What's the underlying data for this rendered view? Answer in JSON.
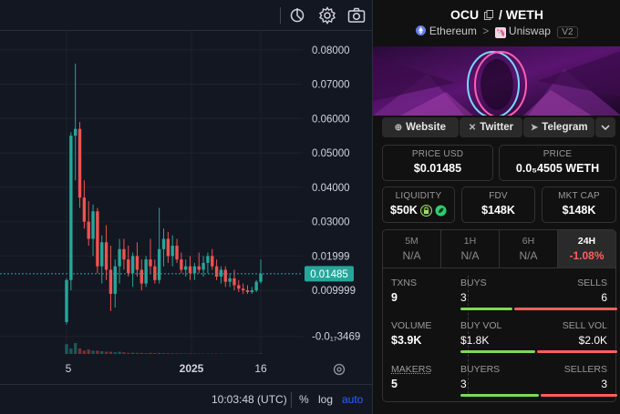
{
  "chart": {
    "price_axis": [
      "0.08000",
      "0.07000",
      "0.06000",
      "0.05000",
      "0.04000",
      "0.03000",
      "0.01999",
      "0.009999",
      "-0.0₁₇3469"
    ],
    "current_price_label": "0.01485",
    "x_ticks": [
      "5",
      "2025",
      "16"
    ],
    "time_label": "10:03:48 (UTC)",
    "percent_label": "%",
    "log_label": "log",
    "auto_label": "auto",
    "colors": {
      "up": "#26a69a",
      "down": "#ef5350",
      "background": "#131722"
    }
  },
  "chart_data": {
    "type": "candlestick",
    "y_range": [
      -0.0085,
      0.0855
    ],
    "x_ticks": [
      "5",
      "2025",
      "16"
    ],
    "current_price": 0.01485,
    "candles": [
      {
        "o": 0.0008,
        "h": 0.0135,
        "l": 0.0001,
        "c": 0.013
      },
      {
        "o": 0.013,
        "h": 0.056,
        "l": 0.01,
        "c": 0.055
      },
      {
        "o": 0.055,
        "h": 0.076,
        "l": 0.042,
        "c": 0.057
      },
      {
        "o": 0.057,
        "h": 0.059,
        "l": 0.034,
        "c": 0.037
      },
      {
        "o": 0.037,
        "h": 0.042,
        "l": 0.028,
        "c": 0.03
      },
      {
        "o": 0.03,
        "h": 0.036,
        "l": 0.023,
        "c": 0.025
      },
      {
        "o": 0.025,
        "h": 0.035,
        "l": 0.02,
        "c": 0.033
      },
      {
        "o": 0.033,
        "h": 0.034,
        "l": 0.015,
        "c": 0.017
      },
      {
        "o": 0.017,
        "h": 0.026,
        "l": 0.012,
        "c": 0.024
      },
      {
        "o": 0.024,
        "h": 0.029,
        "l": 0.013,
        "c": 0.016
      },
      {
        "o": 0.016,
        "h": 0.023,
        "l": 0.004,
        "c": 0.009
      },
      {
        "o": 0.009,
        "h": 0.019,
        "l": 0.005,
        "c": 0.017
      },
      {
        "o": 0.017,
        "h": 0.025,
        "l": 0.012,
        "c": 0.022
      },
      {
        "o": 0.022,
        "h": 0.025,
        "l": 0.016,
        "c": 0.019
      },
      {
        "o": 0.019,
        "h": 0.023,
        "l": 0.014,
        "c": 0.015
      },
      {
        "o": 0.015,
        "h": 0.021,
        "l": 0.011,
        "c": 0.02
      },
      {
        "o": 0.02,
        "h": 0.024,
        "l": 0.014,
        "c": 0.016
      },
      {
        "o": 0.016,
        "h": 0.019,
        "l": 0.01,
        "c": 0.012
      },
      {
        "o": 0.012,
        "h": 0.02,
        "l": 0.011,
        "c": 0.019
      },
      {
        "o": 0.019,
        "h": 0.025,
        "l": 0.015,
        "c": 0.017
      },
      {
        "o": 0.017,
        "h": 0.019,
        "l": 0.012,
        "c": 0.013
      },
      {
        "o": 0.013,
        "h": 0.034,
        "l": 0.012,
        "c": 0.022
      },
      {
        "o": 0.022,
        "h": 0.028,
        "l": 0.017,
        "c": 0.025
      },
      {
        "o": 0.025,
        "h": 0.027,
        "l": 0.018,
        "c": 0.02
      },
      {
        "o": 0.02,
        "h": 0.026,
        "l": 0.017,
        "c": 0.023
      },
      {
        "o": 0.023,
        "h": 0.025,
        "l": 0.018,
        "c": 0.019
      },
      {
        "o": 0.019,
        "h": 0.021,
        "l": 0.015,
        "c": 0.016
      },
      {
        "o": 0.016,
        "h": 0.019,
        "l": 0.014,
        "c": 0.017
      },
      {
        "o": 0.017,
        "h": 0.02,
        "l": 0.013,
        "c": 0.015
      },
      {
        "o": 0.015,
        "h": 0.018,
        "l": 0.013,
        "c": 0.017
      },
      {
        "o": 0.017,
        "h": 0.021,
        "l": 0.015,
        "c": 0.016
      },
      {
        "o": 0.016,
        "h": 0.02,
        "l": 0.014,
        "c": 0.018
      },
      {
        "o": 0.018,
        "h": 0.021,
        "l": 0.015,
        "c": 0.02
      },
      {
        "o": 0.02,
        "h": 0.022,
        "l": 0.016,
        "c": 0.017
      },
      {
        "o": 0.017,
        "h": 0.019,
        "l": 0.013,
        "c": 0.014
      },
      {
        "o": 0.014,
        "h": 0.017,
        "l": 0.012,
        "c": 0.016
      },
      {
        "o": 0.016,
        "h": 0.017,
        "l": 0.011,
        "c": 0.0125
      },
      {
        "o": 0.0125,
        "h": 0.015,
        "l": 0.011,
        "c": 0.0135
      },
      {
        "o": 0.0135,
        "h": 0.016,
        "l": 0.01,
        "c": 0.0115
      },
      {
        "o": 0.0115,
        "h": 0.013,
        "l": 0.0095,
        "c": 0.0105
      },
      {
        "o": 0.0105,
        "h": 0.012,
        "l": 0.009,
        "c": 0.01
      },
      {
        "o": 0.01,
        "h": 0.0115,
        "l": 0.009,
        "c": 0.0095
      },
      {
        "o": 0.0095,
        "h": 0.011,
        "l": 0.009,
        "c": 0.01
      },
      {
        "o": 0.01,
        "h": 0.013,
        "l": 0.0095,
        "c": 0.0125
      },
      {
        "o": 0.0125,
        "h": 0.019,
        "l": 0.012,
        "c": 0.01485
      }
    ],
    "volumes": [
      0.9,
      0.5,
      1.0,
      0.5,
      0.3,
      0.4,
      0.3,
      0.3,
      0.25,
      0.2,
      0.2,
      0.15,
      0.2,
      0.15,
      0.1,
      0.12,
      0.1,
      0.1,
      0.08,
      0.1,
      0.08,
      0.1,
      0.08,
      0.06,
      0.06,
      0.05,
      0.05,
      0.04,
      0.04,
      0.04,
      0.03,
      0.03,
      0.03,
      0.03,
      0.03,
      0.03,
      0.02,
      0.02,
      0.02,
      0.02,
      0.02,
      0.02,
      0.02,
      0.02,
      0.05
    ]
  },
  "pair": {
    "base": "OCU",
    "separator": "/",
    "quote": "WETH",
    "chain": "Ethereum",
    "arrow": ">",
    "dex": "Uniswap",
    "version": "V2"
  },
  "links": {
    "website": "Website",
    "twitter": "Twitter",
    "telegram": "Telegram"
  },
  "metrics": {
    "price_usd_label": "PRICE USD",
    "price_usd": "$0.01485",
    "price_label": "PRICE",
    "price_native": "0.0₅4505 WETH",
    "liquidity_label": "LIQUIDITY",
    "liquidity": "$50K",
    "fdv_label": "FDV",
    "fdv": "$148K",
    "mcap_label": "MKT CAP",
    "mcap": "$148K"
  },
  "timeframes": [
    {
      "label": "5M",
      "value": "N/A"
    },
    {
      "label": "1H",
      "value": "N/A"
    },
    {
      "label": "6H",
      "value": "N/A"
    },
    {
      "label": "24H",
      "value": "-1.08%"
    }
  ],
  "stats": {
    "txns_label": "TXNS",
    "txns": "9",
    "buys_label": "BUYS",
    "buys": "3",
    "sells_label": "SELLS",
    "sells": "6",
    "volume_label": "VOLUME",
    "volume": "$3.9K",
    "buy_vol_label": "BUY VOL",
    "buy_vol": "$1.8K",
    "sell_vol_label": "SELL VOL",
    "sell_vol": "$2.0K",
    "makers_label": "MAKERS",
    "makers": "5",
    "buyers_label": "BUYERS",
    "buyers": "3",
    "sellers_label": "SELLERS",
    "sellers": "3",
    "buys_ratio": 0.333,
    "buy_vol_ratio": 0.474,
    "buyers_ratio": 0.5
  }
}
